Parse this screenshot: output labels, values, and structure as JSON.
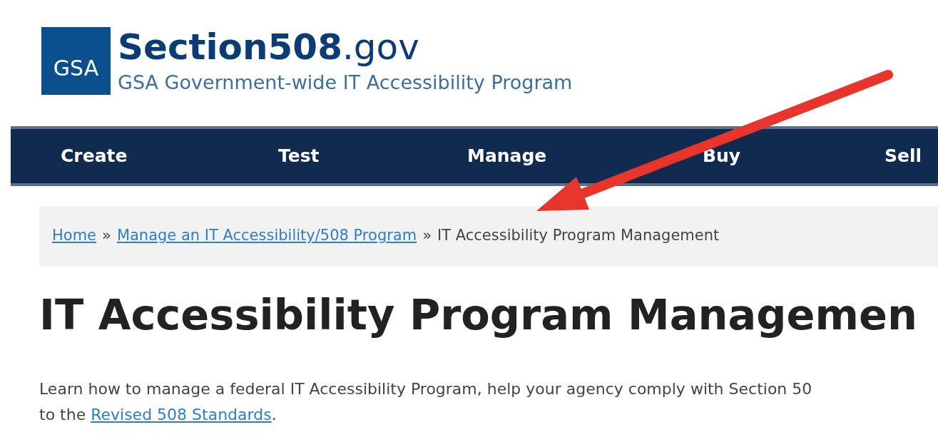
{
  "logo": {
    "mark": "GSA",
    "title": "Section508",
    "title_suffix": ".gov",
    "subtitle": "GSA Government-wide IT Accessibility Program"
  },
  "nav": [
    {
      "label": "Create"
    },
    {
      "label": "Test"
    },
    {
      "label": "Manage"
    },
    {
      "label": "Buy"
    },
    {
      "label": "Sell"
    }
  ],
  "breadcrumb": [
    {
      "label": "Home",
      "link": true
    },
    {
      "label": "Manage an IT Accessibility/508 Program",
      "link": true
    },
    {
      "label": "IT Accessibility Program Management",
      "link": false
    }
  ],
  "breadcrumb_separator": "»",
  "heading": "IT Accessibility Program Managemen",
  "intro": {
    "line_1": "Learn how to manage a federal IT Accessibility Program, help your agency comply with Section 50",
    "line_2_start": "to the ",
    "link": "Revised 508 Standards",
    "line_2_end": "."
  }
}
